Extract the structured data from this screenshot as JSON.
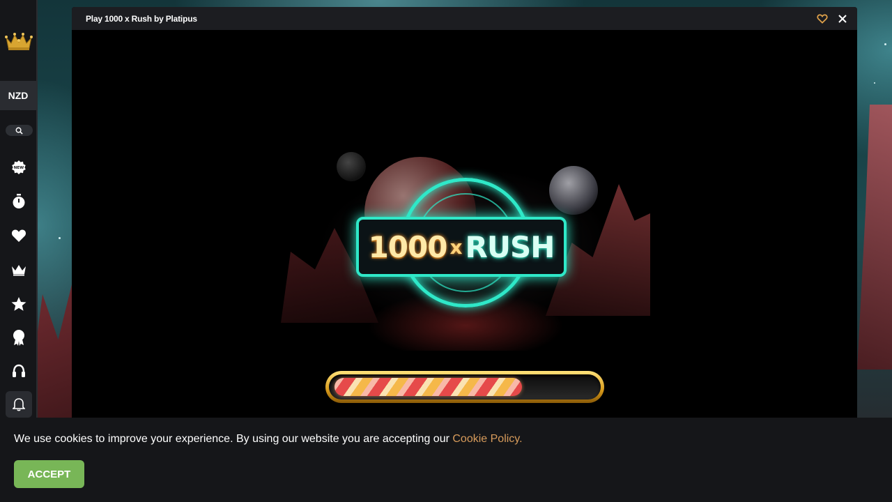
{
  "sidebar": {
    "logo_icon": "crown-logo-icon",
    "currency": "NZD",
    "search_icon": "search-icon",
    "nav_items": [
      {
        "icon": "new-badge-icon"
      },
      {
        "icon": "stopwatch-icon"
      },
      {
        "icon": "heart-icon"
      },
      {
        "icon": "crown-icon"
      },
      {
        "icon": "star-icon"
      },
      {
        "icon": "award-ribbon-icon"
      },
      {
        "icon": "headset-icon"
      },
      {
        "icon": "bell-icon"
      }
    ]
  },
  "game_window": {
    "title": "Play 1000 x Rush by Platipus",
    "favorite_icon": "heart-outline-icon",
    "close_icon": "close-icon",
    "splash": {
      "logo_number": "1000",
      "logo_x": "x",
      "logo_word": "RUSH"
    },
    "loading_progress": 0.72
  },
  "cookie_banner": {
    "text": "We use cookies to improve your experience. By using our website you are accepting our ",
    "link_text": "Cookie Policy.",
    "accept_label": "ACCEPT"
  },
  "colors": {
    "accent_teal": "#2fe8c8",
    "accept_green": "#78b657",
    "link_orange": "#d79b5b",
    "favorite_gold": "#e0a24a"
  }
}
